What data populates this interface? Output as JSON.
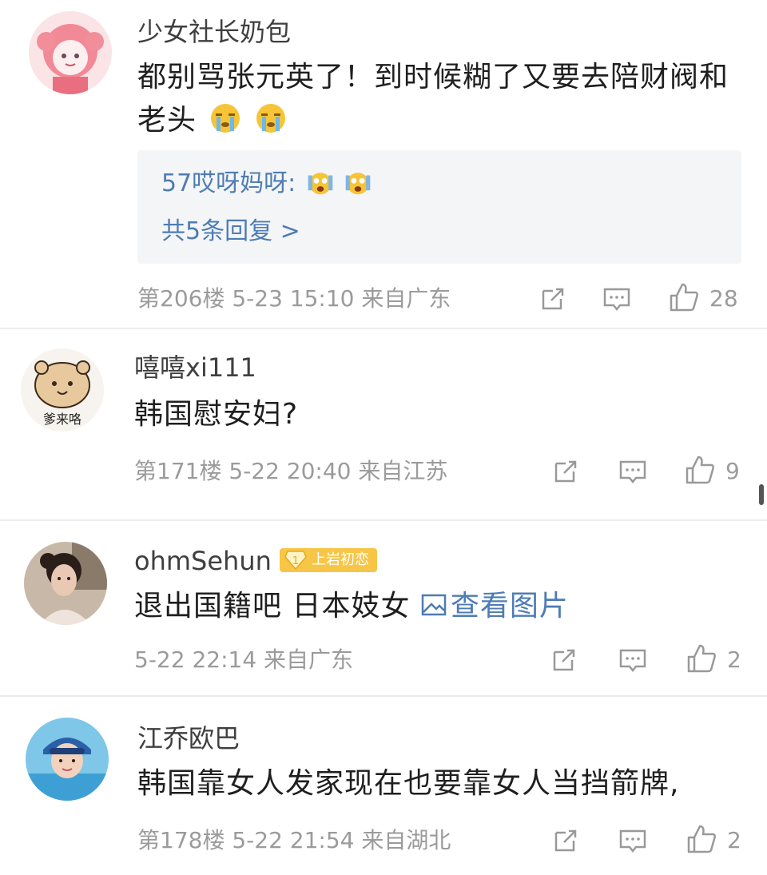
{
  "comments": [
    {
      "username": "少女社长奶包",
      "text_line1": "都别骂张元英了！到时候糊了又要去陪财阀和",
      "text_line2": "老头",
      "emoji": "crying-face",
      "reply_preview": {
        "author": "57哎呀妈呀:",
        "emoji": "screaming-face",
        "more_label": "共5条回复 >"
      },
      "floor": "第206楼",
      "time": "5-23 15:10",
      "location": "来自广东",
      "likes": "28"
    },
    {
      "username": "嘻嘻xi111",
      "avatar_caption": "爹来咯",
      "text_line1": "韩国慰安妇?",
      "floor": "第171楼",
      "time": "5-22 20:40",
      "location": "来自江苏",
      "likes": "9"
    },
    {
      "username": "ohmSehun",
      "badge": "上岩初恋",
      "text_line1": "退出国籍吧 日本妓女",
      "image_link": "查看图片",
      "time": "5-22 22:14",
      "location": "来自广东",
      "likes": "2"
    },
    {
      "username": "江乔欧巴",
      "text_line1": "韩国靠女人发家现在也要靠女人当挡箭牌,",
      "floor": "第178楼",
      "time": "5-22 21:54",
      "location": "来自湖北",
      "likes": "2"
    }
  ],
  "colors": {
    "link": "#4e7cb3",
    "meta": "#9b9b9b",
    "badge": "#f7c646"
  }
}
